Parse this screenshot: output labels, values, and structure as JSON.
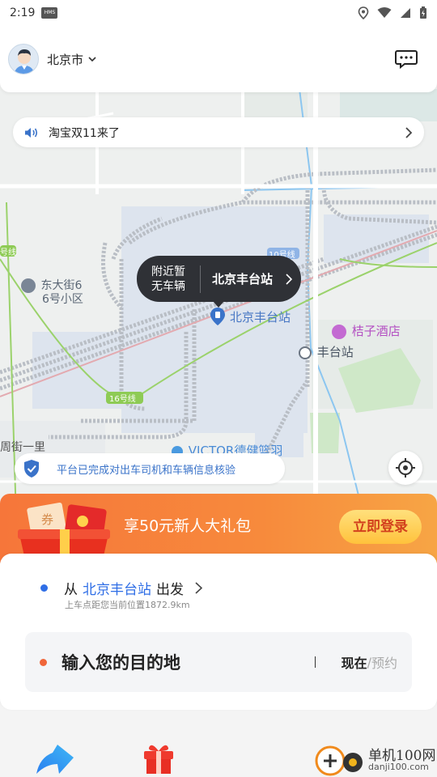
{
  "status_bar": {
    "time": "2:19",
    "app_badge": "HMS"
  },
  "header": {
    "city": "北京市"
  },
  "notice": {
    "text": "淘宝双11来了"
  },
  "map": {
    "pois": {
      "residential": "东大街6\n6号小区",
      "residential_line1": "东大街6",
      "residential_line2": "6号小区",
      "station_label": "北京丰台站",
      "hotel": "桔子酒店",
      "fengtai_station": "丰台站",
      "victor": "VICTOR德健篮羽",
      "street": "周街一里",
      "line16": "16号线",
      "line10": "10号线",
      "line_left": "号线"
    }
  },
  "bubble": {
    "no_vehicle_line1": "附近暂",
    "no_vehicle_line2": "无车辆",
    "station": "北京丰台站"
  },
  "verify": {
    "text": "平台已完成对出车司机和车辆信息核验"
  },
  "promo": {
    "coupon_tag": "券",
    "title": "享50元新人大礼包",
    "login_button": "立即登录"
  },
  "trip": {
    "from_prefix": "从",
    "from_station": "北京丰台站",
    "from_suffix": "出发",
    "distance": "上车点距您当前位置1872.9km",
    "destination_placeholder": "输入您的目的地",
    "now": "现在",
    "slash": "/",
    "reserve": "预约"
  },
  "watermark": {
    "title": "单机100网",
    "sub": "danji100.com"
  },
  "colors": {
    "accent_blue": "#2f6ee6",
    "orange": "#f0663a",
    "promo_orange": "#f6763a",
    "bubble_dark": "#2f3136"
  }
}
